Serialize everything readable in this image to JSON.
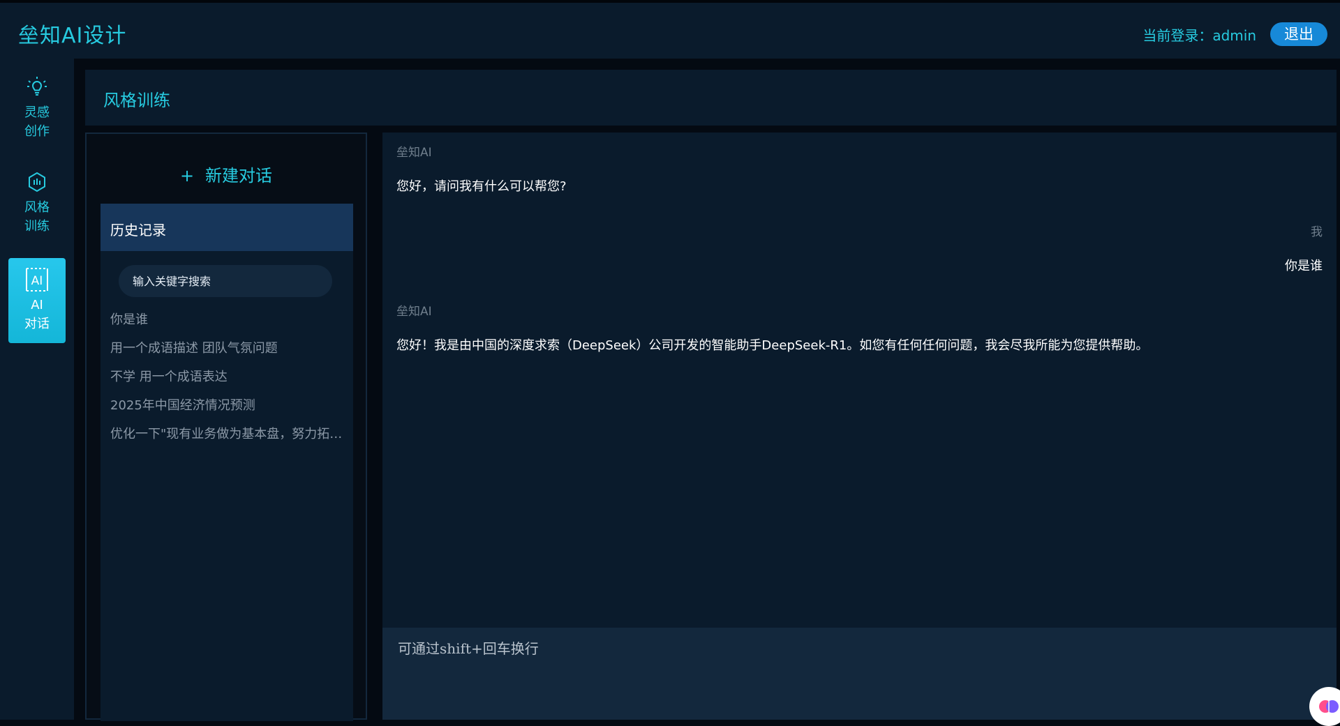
{
  "app": {
    "title": "垒知AI设计"
  },
  "header": {
    "login_label": "当前登录：admin",
    "logout_label": "退出"
  },
  "nav": [
    {
      "label": "灵感\n创作",
      "icon": "lightbulb-icon"
    },
    {
      "label": "风格\n训练",
      "icon": "hexagon-chart-icon"
    },
    {
      "label": "AI\n对话",
      "icon": "ai-box-icon",
      "active": true
    }
  ],
  "page": {
    "title": "风格训练"
  },
  "history": {
    "new_chat_label": "新建对话",
    "header_label": "历史记录",
    "search_placeholder": "输入关键字搜索",
    "items": [
      "你是谁",
      "用一个成语描述 团队气氛问题",
      "不学 用一个成语表达",
      "2025年中国经济情况预测",
      "优化一下\"现有业务做为基本盘，努力拓展新业务\""
    ]
  },
  "chat": {
    "messages": [
      {
        "role": "ai",
        "sender": "垒知AI",
        "text": "您好，请问我有什么可以帮您?"
      },
      {
        "role": "user",
        "sender": "我",
        "text": "你是谁"
      },
      {
        "role": "ai",
        "sender": "垒知AI",
        "text": "您好！我是由中国的深度求索（DeepSeek）公司开发的智能助手DeepSeek-R1。如您有任何任何问题，我会尽我所能为您提供帮助。"
      }
    ],
    "input_placeholder": "可通过shift+回车换行"
  },
  "colors": {
    "accent": "#27cbe0",
    "button": "#1789d8",
    "panel": "#0a1b2c",
    "background": "#040a12"
  }
}
